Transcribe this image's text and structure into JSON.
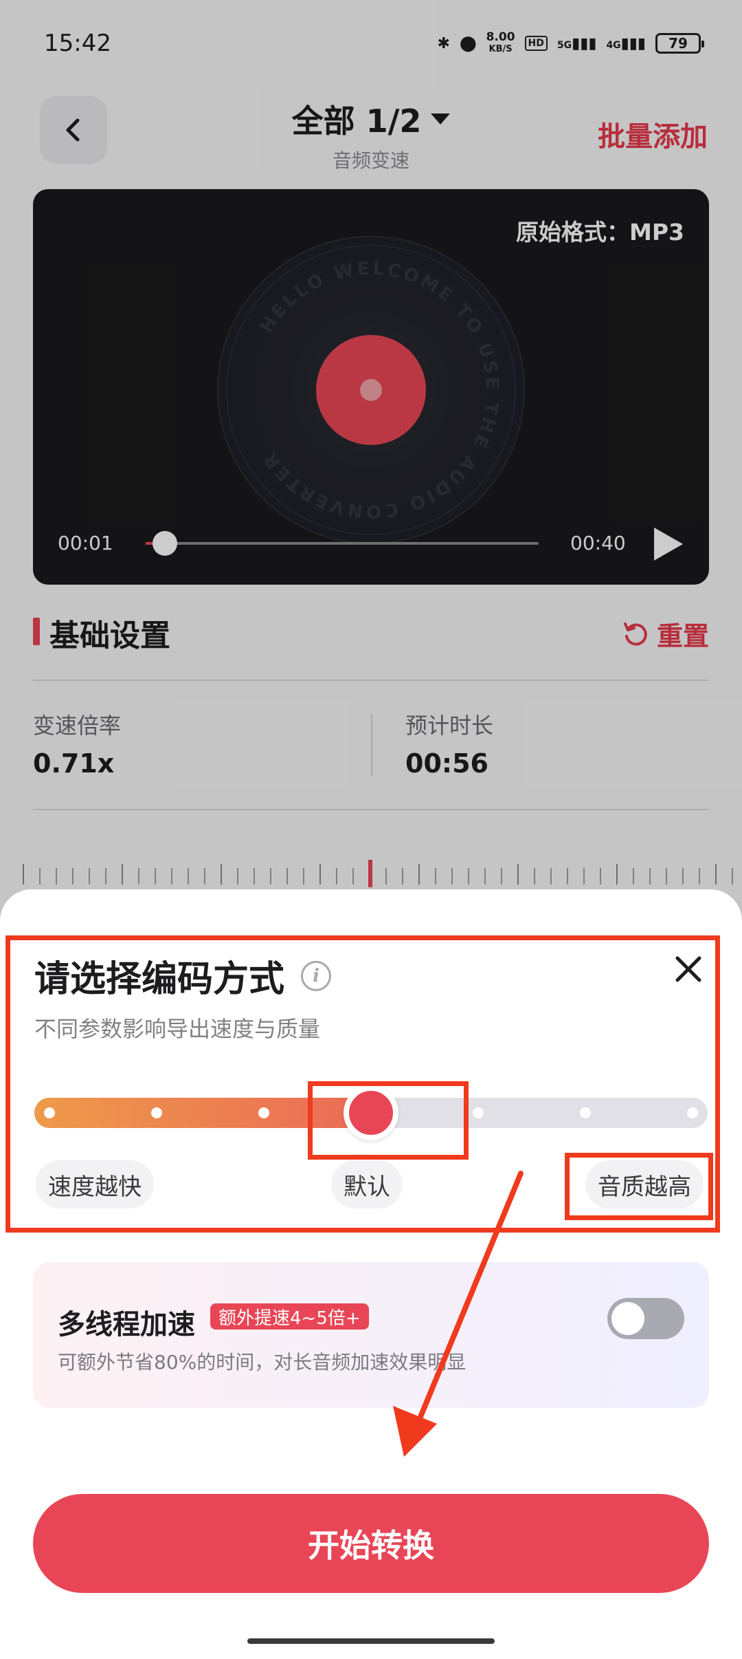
{
  "status_bar": {
    "time": "15:42",
    "net_speed_value": "8.00",
    "net_speed_unit": "KB/S",
    "hd_label": "HD",
    "signal1": "5G",
    "signal2": "4G",
    "battery": "79"
  },
  "header": {
    "title": "全部 1/2",
    "subtitle": "音频变速",
    "batch_add": "批量添加"
  },
  "player": {
    "format_label": "原始格式：MP3",
    "disc_text": "HELLO WELCOME TO USE THE AUDIO CONVERTER",
    "current_time": "00:01",
    "total_time": "00:40",
    "progress": 0.025
  },
  "basic_settings": {
    "title": "基础设置",
    "reset": "重置",
    "speed_label": "变速倍率",
    "speed_value": "0.71x",
    "duration_label": "预计时长",
    "duration_value": "00:56"
  },
  "sheet": {
    "title": "请选择编码方式",
    "subtitle": "不同参数影响导出速度与质量",
    "slider_steps": 7,
    "slider_selected_index": 3,
    "label_left": "速度越快",
    "label_mid": "默认",
    "label_right": "音质越高"
  },
  "multithread": {
    "title": "多线程加速",
    "badge": "额外提速4~5倍+",
    "desc": "可额外节省80%的时间，对长音频加速效果明显",
    "enabled": false
  },
  "start_button": "开始转换",
  "colors": {
    "accent": "#e84656",
    "annotation": "#f03a1e"
  }
}
